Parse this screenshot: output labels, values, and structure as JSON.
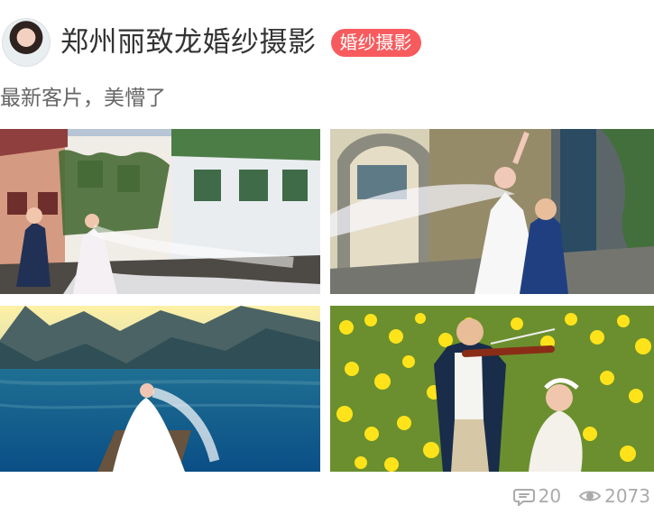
{
  "header": {
    "title": "郑州丽致龙婚纱摄影",
    "tag": "婚纱摄影"
  },
  "post": {
    "caption": "最新客片，美懵了"
  },
  "photos": [
    {
      "name": "wedding-photo-village",
      "alt": "Wedding couple in a village street"
    },
    {
      "name": "wedding-photo-arch",
      "alt": "Bride with flowing veil by stone arch"
    },
    {
      "name": "wedding-photo-lake",
      "alt": "Bride on lake dock at sunset"
    },
    {
      "name": "wedding-photo-flowers",
      "alt": "Couple with violin in yellow flower field"
    }
  ],
  "stats": {
    "comments": "20",
    "views": "2073"
  },
  "colors": {
    "tag_background": "#f85b5d",
    "title_text": "#333333",
    "muted_text": "#aaaaaa"
  },
  "icons": [
    "avatar-image",
    "comment-icon",
    "view-eye-icon"
  ]
}
